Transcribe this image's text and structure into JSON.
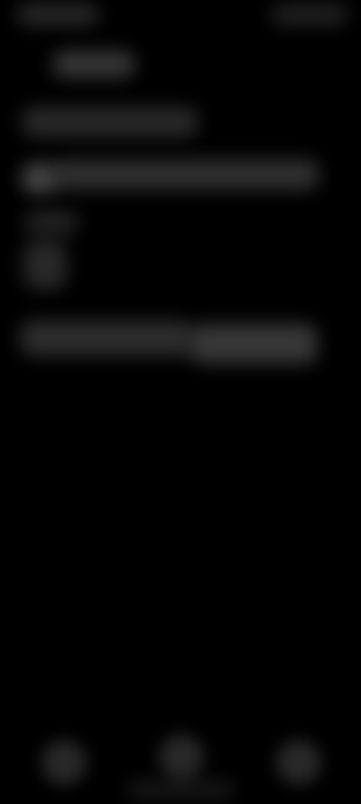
{
  "screen": {
    "background_color": "#000000",
    "blur_color": "#4a4a4a"
  },
  "status_bar": {
    "left_text": "",
    "right_text": ""
  },
  "header": {
    "title": ""
  },
  "content": {
    "section_title": "",
    "row_text": "",
    "secondary_text_1": "",
    "secondary_text_2": "",
    "button_left_label": "",
    "button_right_label": ""
  },
  "bottom_nav": {
    "items": [
      {
        "label": ""
      },
      {
        "label": ""
      },
      {
        "label": ""
      }
    ]
  }
}
